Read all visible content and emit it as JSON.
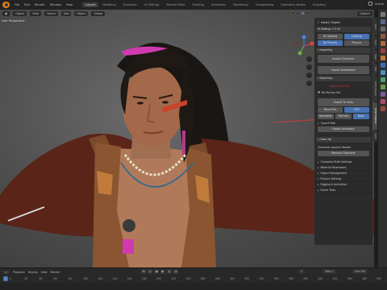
{
  "topbar": {
    "menus": [
      "File",
      "Edit",
      "Render",
      "Window",
      "Help"
    ],
    "workspaces": [
      "Layout",
      "Modeling",
      "Sculpting",
      "UV Editing",
      "Texture Paint",
      "Shading",
      "Animation",
      "Rendering",
      "Compositing",
      "Geometry Nodes",
      "Scripting"
    ],
    "active_workspace": "Layout",
    "scene_label": "Scene"
  },
  "viewport": {
    "mode": "Object",
    "menus": [
      "View",
      "Select",
      "Add",
      "Object"
    ],
    "orientation": "Global",
    "options_label": "Options",
    "view_label": "User Perspective"
  },
  "panel": {
    "header": "Import / Export",
    "settings_label": "Settings",
    "version": "1.3.10",
    "lighting_buttons": [
      "Rl-Lighting",
      "Lighting"
    ],
    "physics_buttons": [
      "No Physics",
      "Physics"
    ],
    "importing_label": "Importing",
    "import_character": "Import Character",
    "import_animations": "Import Animations",
    "exporting_label": "Exporting",
    "export_to_cc3": "Export to CC3/4",
    "no_key_label": "No Mo-key Set",
    "export_to_unity": "Export To Unity",
    "format_buttons": [
      "Blend File",
      "FBX"
    ],
    "scope_buttons": [
      "Animation",
      "Textures",
      "Bake"
    ],
    "export_path": "Export Path",
    "export_accessory": "Export Accessory",
    "cleanup_label": "Clean Up",
    "character_name_label": "Character Apache Header",
    "remove_character": "Remove Character",
    "sections": [
      "Character Build Settings",
      "Material Parameters",
      "Object Management",
      "Physics Settings",
      "Rigging & Animation",
      "Scene Tools"
    ]
  },
  "vtabs": [
    "Item",
    "Tool",
    "View",
    "Edit",
    "CC/iC Create",
    "CC/iC Pipeline",
    "Link"
  ],
  "vtabs_active": "CC/iC Pipeline",
  "timeline": {
    "menus": [
      "Playback",
      "Keying",
      "View",
      "Marker"
    ],
    "current_frame": "1",
    "start_label": "Start",
    "start_value": "1",
    "end_label": "End",
    "end_value": "250",
    "ticks": [
      "0",
      "20",
      "40",
      "60",
      "80",
      "100",
      "120",
      "140",
      "160",
      "180",
      "200",
      "220",
      "240",
      "260",
      "280",
      "300",
      "320",
      "340",
      "360",
      "380",
      "400",
      "420",
      "440",
      "460",
      "480",
      "500"
    ]
  },
  "colors": {
    "accent": "#4772b3",
    "orange": "#e87d0d",
    "red": "#d23a3a"
  }
}
